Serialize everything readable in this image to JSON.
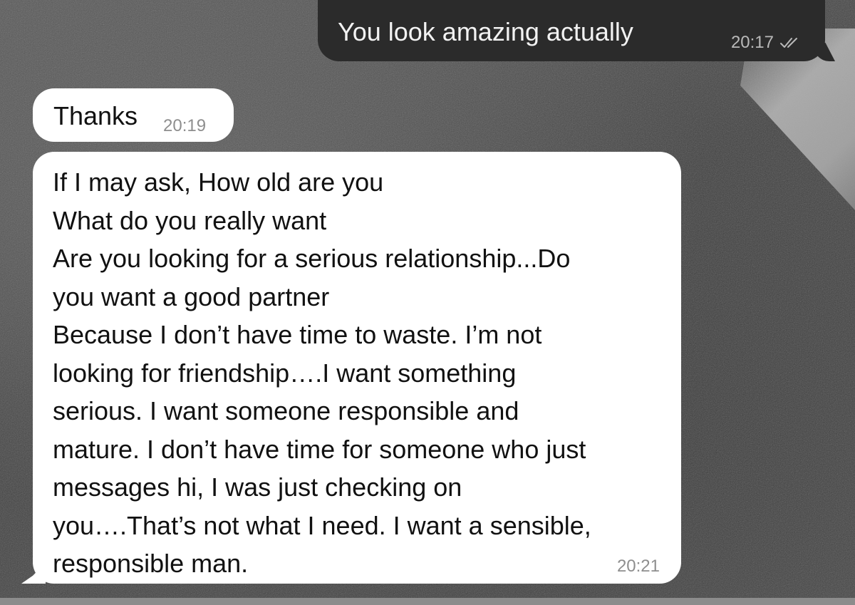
{
  "chat": {
    "outgoing": [
      {
        "text": "You look amazing actually",
        "time": "20:17",
        "status_icon": "double-check-icon"
      }
    ],
    "incoming": [
      {
        "text": "Thanks",
        "time": "20:19"
      },
      {
        "lines": [
          "If I may ask, How old are you",
          "What do you really want",
          "Are you looking for a serious relationship...Do",
          "you want a good partner",
          "Because I don’t have time to waste. I’m not",
          "looking for friendship….I want something",
          "serious. I want someone responsible and",
          "mature. I don’t have time for someone who just",
          "messages hi, I was just checking on",
          "you….That’s not what I need. I want a sensible,",
          "responsible man."
        ],
        "time": "20:21"
      }
    ]
  },
  "colors": {
    "outgoing_bubble": "#2b2b2b",
    "incoming_bubble": "#ffffff",
    "background": "#4a4a4a",
    "timestamp": "#8e8e8e"
  }
}
